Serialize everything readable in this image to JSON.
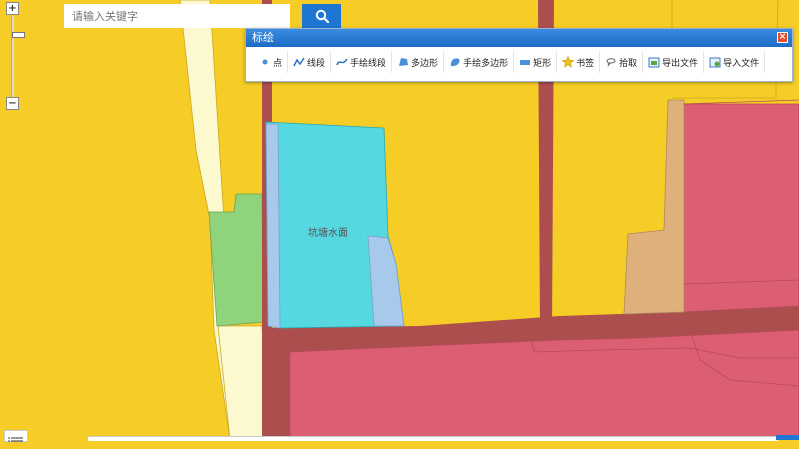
{
  "search": {
    "placeholder": "请输入关键字",
    "icon": "search-icon"
  },
  "zoom": {
    "in_label": "+",
    "out_label": "−"
  },
  "panel": {
    "title": "标绘",
    "tools": [
      {
        "label": "点",
        "icon": "point-icon"
      },
      {
        "label": "线段",
        "icon": "polyline-icon"
      },
      {
        "label": "手绘线段",
        "icon": "freehand-line-icon"
      },
      {
        "label": "多边形",
        "icon": "polygon-icon"
      },
      {
        "label": "手绘多边形",
        "icon": "freehand-polygon-icon"
      },
      {
        "label": "矩形",
        "icon": "rectangle-icon"
      },
      {
        "label": "书签",
        "icon": "star-icon"
      },
      {
        "label": "拾取",
        "icon": "pick-icon"
      },
      {
        "label": "导出文件",
        "icon": "export-icon"
      },
      {
        "label": "导入文件",
        "icon": "import-icon"
      }
    ]
  },
  "map": {
    "label_water": "坑塘水面"
  },
  "colors": {
    "land_yellow": "#f5cd26",
    "road": "#ac4e4e",
    "pink": "#dc5e72",
    "cyan": "#55d8e0",
    "light_blue": "#a6c9ec",
    "green": "#8fd47c",
    "cream": "#fcf9cf",
    "tan": "#deb07c",
    "accent": "#1e76d2"
  }
}
